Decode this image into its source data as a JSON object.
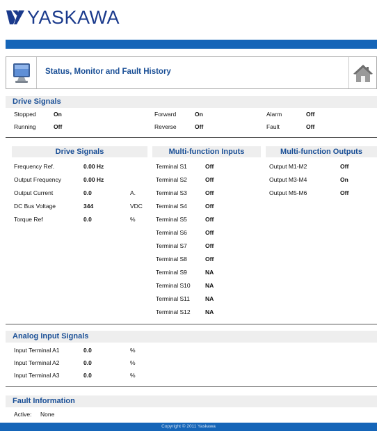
{
  "brand": {
    "name": "YASKAWA",
    "color": "#1a3a8c"
  },
  "accent_color": "#1565b8",
  "header": {
    "title": "Status, Monitor and Fault History",
    "monitor_icon": "monitor-icon",
    "home_icon": "home-icon"
  },
  "drive_status": {
    "title": "Drive Signals",
    "rows": [
      [
        {
          "label": "Stopped",
          "value": "On"
        },
        {
          "label": "Forward",
          "value": "On"
        },
        {
          "label": "Alarm",
          "value": "Off"
        }
      ],
      [
        {
          "label": "Running",
          "value": "Off"
        },
        {
          "label": "Reverse",
          "value": "Off"
        },
        {
          "label": "Fault",
          "value": "Off"
        }
      ]
    ]
  },
  "drive_signals": {
    "title": "Drive Signals",
    "rows": [
      {
        "label": "Frequency Ref.",
        "value": "0.00 Hz",
        "unit": ""
      },
      {
        "label": "Output Frequency",
        "value": "0.00 Hz",
        "unit": ""
      },
      {
        "label": "Output Current",
        "value": "0.0",
        "unit": "A."
      },
      {
        "label": "DC Bus Voltage",
        "value": "344",
        "unit": "VDC"
      },
      {
        "label": "Torque Ref",
        "value": "0.0",
        "unit": "%"
      }
    ]
  },
  "multi_inputs": {
    "title": "Multi-function Inputs",
    "rows": [
      {
        "label": "Terminal S1",
        "value": "Off"
      },
      {
        "label": "Terminal S2",
        "value": "Off"
      },
      {
        "label": "Terminal S3",
        "value": "Off"
      },
      {
        "label": "Terminal S4",
        "value": "Off"
      },
      {
        "label": "Terminal S5",
        "value": "Off"
      },
      {
        "label": "Terminal S6",
        "value": "Off"
      },
      {
        "label": "Terminal S7",
        "value": "Off"
      },
      {
        "label": "Terminal S8",
        "value": "Off"
      },
      {
        "label": "Terminal S9",
        "value": "NA"
      },
      {
        "label": "Terminal S10",
        "value": "NA"
      },
      {
        "label": "Terminal S11",
        "value": "NA"
      },
      {
        "label": "Terminal S12",
        "value": "NA"
      }
    ]
  },
  "multi_outputs": {
    "title": "Multi-function Outputs",
    "rows": [
      {
        "label": "Output M1-M2",
        "value": "Off"
      },
      {
        "label": "Output M3-M4",
        "value": "On"
      },
      {
        "label": "Output M5-M6",
        "value": "Off"
      }
    ]
  },
  "analog_inputs": {
    "title": "Analog Input Signals",
    "rows": [
      {
        "label": "Input Terminal A1",
        "value": "0.0",
        "unit": "%"
      },
      {
        "label": "Input Terminal A2",
        "value": "0.0",
        "unit": "%"
      },
      {
        "label": "Input Terminal A3",
        "value": "0.0",
        "unit": "%"
      }
    ]
  },
  "fault": {
    "title": "Fault Information",
    "label": "Active:",
    "value": "None"
  },
  "footer": {
    "text": "Copyright © 2011 Yaskawa"
  }
}
